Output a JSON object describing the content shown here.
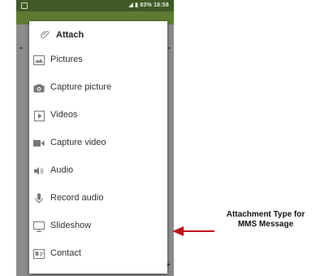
{
  "status_bar": {
    "time": "18:58",
    "battery": "83%"
  },
  "popup": {
    "title": "Attach",
    "items": [
      {
        "label": "Pictures",
        "icon": "image-icon"
      },
      {
        "label": "Capture picture",
        "icon": "camera-icon"
      },
      {
        "label": "Videos",
        "icon": "video-file-icon"
      },
      {
        "label": "Capture video",
        "icon": "video-camera-icon"
      },
      {
        "label": "Audio",
        "icon": "speaker-icon"
      },
      {
        "label": "Record audio",
        "icon": "microphone-icon"
      },
      {
        "label": "Slideshow",
        "icon": "monitor-icon"
      },
      {
        "label": "Contact",
        "icon": "contact-card-icon"
      }
    ]
  },
  "annotation": {
    "line1": "Attachment Type for",
    "line2": "MMS Message"
  },
  "colors": {
    "status_bar": "#3f5a26",
    "action_bar": "#5d7b33",
    "arrow": "#c0101c"
  }
}
